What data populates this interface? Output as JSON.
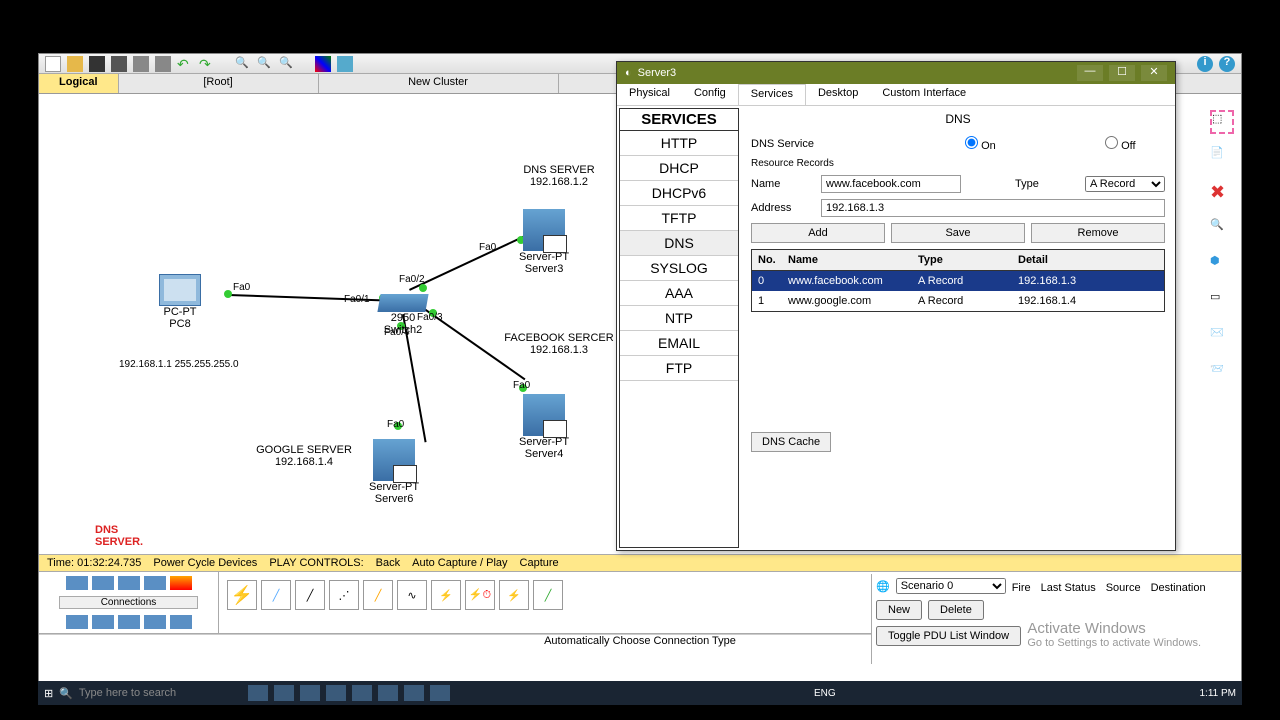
{
  "main_tabs": {
    "logical": "Logical",
    "root": "[Root]",
    "new_cluster": "New Cluster"
  },
  "topology": {
    "dns_server": {
      "title": "DNS SERVER",
      "ip": "192.168.1.2",
      "dev": "Server-PT",
      "name": "Server3",
      "port": "Fa0"
    },
    "pc": {
      "dev": "PC-PT",
      "name": "PC8",
      "ip_mask": "192.168.1.1 255.255.255.0",
      "port": "Fa0"
    },
    "switch": {
      "name": "2950",
      "sub": "Switch2",
      "p1": "Fa0/1",
      "p2": "Fa0/2",
      "p3": "Fa0/3",
      "p4": "Fa0/4"
    },
    "fb_server": {
      "title": "FACEBOOK SERCER",
      "ip": "192.168.1.3",
      "dev": "Server-PT",
      "name": "Server4",
      "port": "Fa0"
    },
    "google_server": {
      "title": "GOOGLE SERVER",
      "ip": "192.168.1.4",
      "dev": "Server-PT",
      "name": "Server6",
      "port": "Fa0"
    }
  },
  "watermark": {
    "l1": "DNS",
    "l2": "SERVER."
  },
  "time_row": {
    "time": "Time: 01:32:24.735",
    "pcd": "Power Cycle Devices",
    "pc": "PLAY CONTROLS:",
    "back": "Back",
    "auto": "Auto Capture / Play",
    "cap": "Capture"
  },
  "palette": {
    "label": "Connections",
    "auto": "Automatically Choose Connection Type"
  },
  "scenario": {
    "sel": "Scenario 0",
    "new": "New",
    "del": "Delete",
    "toggle": "Toggle PDU List Window",
    "h1": "Fire",
    "h2": "Last Status",
    "h3": "Source",
    "h4": "Destination"
  },
  "activate": {
    "l1": "Activate Windows",
    "l2": "Go to Settings to activate Windows."
  },
  "right_icons": [
    "select",
    "note",
    "delete",
    "search",
    "shape",
    "marquee",
    "msg",
    "msg2"
  ],
  "dialog": {
    "title": "Server3",
    "tabs": [
      "Physical",
      "Config",
      "Services",
      "Desktop",
      "Custom Interface"
    ],
    "tab_sel": 2,
    "services_hdr": "SERVICES",
    "services": [
      "HTTP",
      "DHCP",
      "DHCPv6",
      "TFTP",
      "DNS",
      "SYSLOG",
      "AAA",
      "NTP",
      "EMAIL",
      "FTP"
    ],
    "service_sel": 4,
    "dns": {
      "title": "DNS",
      "service_lbl": "DNS Service",
      "on": "On",
      "off": "Off",
      "on_checked": true,
      "rr": "Resource Records",
      "name_lbl": "Name",
      "name_val": "www.facebook.com",
      "type_lbl": "Type",
      "type_val": "A Record",
      "addr_lbl": "Address",
      "addr_val": "192.168.1.3",
      "add": "Add",
      "save": "Save",
      "remove": "Remove",
      "cols": {
        "no": "No.",
        "name": "Name",
        "type": "Type",
        "detail": "Detail"
      },
      "rows": [
        {
          "no": "0",
          "name": "www.facebook.com",
          "type": "A Record",
          "detail": "192.168.1.3",
          "sel": true
        },
        {
          "no": "1",
          "name": "www.google.com",
          "type": "A Record",
          "detail": "192.168.1.4",
          "sel": false
        }
      ],
      "cache": "DNS Cache"
    }
  },
  "taskbar": {
    "search": "Type here to search",
    "time": "1:11 PM",
    "lang": "ENG"
  }
}
